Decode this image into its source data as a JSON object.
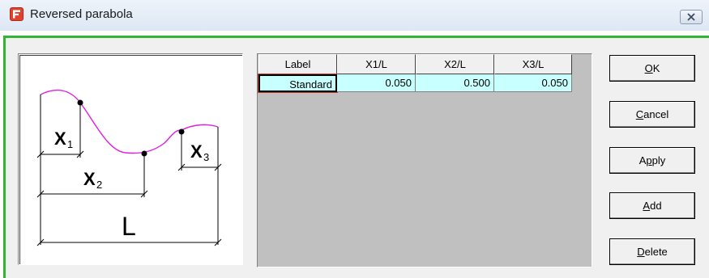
{
  "window": {
    "title": "Reversed parabola",
    "accent_color": "#33b533"
  },
  "diagram": {
    "curve_color": "#e020e0",
    "labels": {
      "x1": "X",
      "x1_sub": "1",
      "x2": "X",
      "x2_sub": "2",
      "x3": "X",
      "x3_sub": "3",
      "l": "L"
    }
  },
  "grid": {
    "headers": [
      "Label",
      "X1/L",
      "X2/L",
      "X3/L"
    ],
    "rows": [
      [
        "Standard",
        "0.050",
        "0.500",
        "0.050"
      ]
    ]
  },
  "buttons": {
    "ok": {
      "mnemonic": "O",
      "rest": "K"
    },
    "cancel": {
      "mnemonic": "C",
      "rest": "ancel"
    },
    "apply": {
      "pre": "A",
      "mnemonic": "p",
      "rest": "ply"
    },
    "add": {
      "mnemonic": "A",
      "rest": "dd"
    },
    "delete": {
      "mnemonic": "D",
      "rest": "elete"
    }
  }
}
